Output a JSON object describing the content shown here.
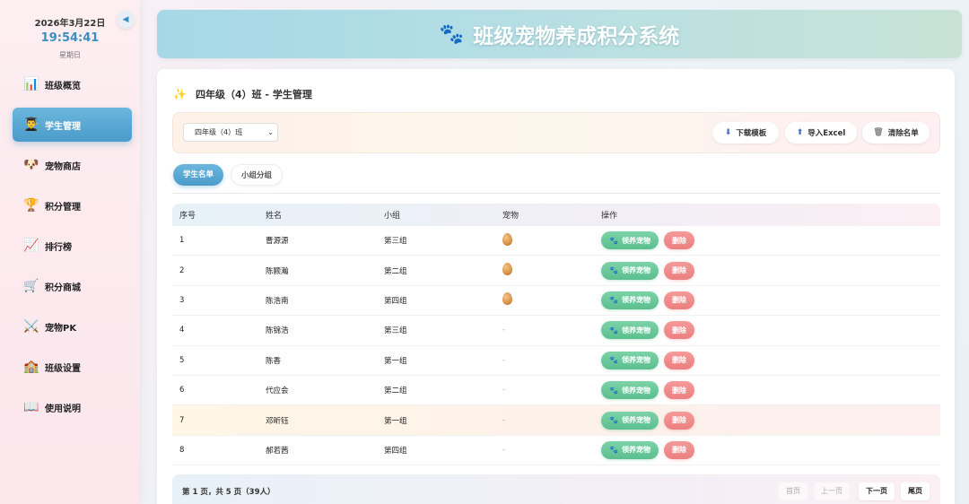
{
  "clock": {
    "date": "2026年3月22日",
    "time": "19:54:41",
    "weekday": "星期日"
  },
  "sidebar": {
    "collapse_icon": "◀",
    "items": [
      {
        "label": "班级概览",
        "icon": "📊"
      },
      {
        "label": "学生管理",
        "icon": "👨‍🎓",
        "active": true
      },
      {
        "label": "宠物商店",
        "icon": "🐶"
      },
      {
        "label": "积分管理",
        "icon": "🏆"
      },
      {
        "label": "排行榜",
        "icon": "📈"
      },
      {
        "label": "积分商城",
        "icon": "🛒"
      },
      {
        "label": "宠物PK",
        "icon": "⚔️"
      },
      {
        "label": "班级设置",
        "icon": "🏫"
      },
      {
        "label": "使用说明",
        "icon": "📖"
      }
    ]
  },
  "header": {
    "icon": "🐾",
    "title": "班级宠物养成积分系统"
  },
  "main": {
    "title_icon": "✨",
    "title": "四年级（4）班 - 学生管理",
    "class_select": {
      "value": "四年级（4）班"
    },
    "toolbar": {
      "download_label": "下载模板",
      "import_label": "导入Excel",
      "clear_label": "清除名单"
    },
    "tabs": [
      {
        "label": "学生名单",
        "active": true
      },
      {
        "label": "小组分组",
        "active": false
      }
    ],
    "table": {
      "headers": [
        "序号",
        "姓名",
        "小组",
        "宠物",
        "操作"
      ],
      "adopt_label": "领养宠物",
      "delete_label": "删除",
      "rows": [
        {
          "no": "1",
          "name": "曹源源",
          "group": "第三组",
          "pet": "egg"
        },
        {
          "no": "2",
          "name": "陈颢瀚",
          "group": "第二组",
          "pet": "egg"
        },
        {
          "no": "3",
          "name": "陈浩南",
          "group": "第四组",
          "pet": "egg"
        },
        {
          "no": "4",
          "name": "陈锦浩",
          "group": "第三组",
          "pet": "-"
        },
        {
          "no": "5",
          "name": "陈香",
          "group": "第一组",
          "pet": "-"
        },
        {
          "no": "6",
          "name": "代应会",
          "group": "第二组",
          "pet": "-"
        },
        {
          "no": "7",
          "name": "邓昕钰",
          "group": "第一组",
          "pet": "-",
          "highlight": true
        },
        {
          "no": "8",
          "name": "郝若茜",
          "group": "第四组",
          "pet": "-"
        }
      ]
    },
    "pager": {
      "info": "第 1 页，共 5 页（39人）",
      "first": "首页",
      "prev": "上一页",
      "next": "下一页",
      "last": "尾页"
    }
  },
  "colors": {
    "accent": "#4a9cc9",
    "adopt": "#5bbf8e",
    "delete": "#ec7f7f"
  }
}
